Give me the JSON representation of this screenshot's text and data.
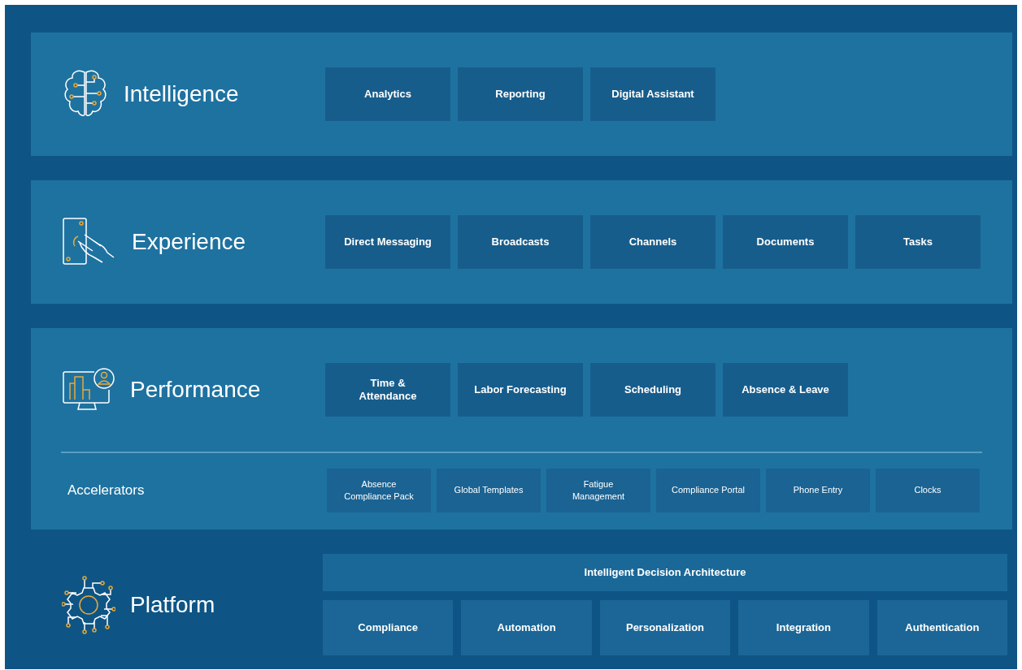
{
  "layers": [
    {
      "kind": "intelligence",
      "title": "Intelligence",
      "modules": [
        "Analytics",
        "Reporting",
        "Digital Assistant"
      ]
    },
    {
      "kind": "experience",
      "title": "Experience",
      "modules": [
        "Direct Messaging",
        "Broadcasts",
        "Channels",
        "Documents",
        "Tasks"
      ]
    },
    {
      "kind": "performance",
      "title": "Performance",
      "modules": [
        "Time &\nAttendance",
        "Labor Forecasting",
        "Scheduling",
        "Absence & Leave"
      ],
      "accelerators": {
        "label": "Accelerators",
        "items": [
          "Absence\nCompliance Pack",
          "Global Templates",
          "Fatigue\nManagement",
          "Compliance Portal",
          "Phone Entry",
          "Clocks"
        ]
      }
    }
  ],
  "platform": {
    "title": "Platform",
    "architecture": "Intelligent Decision Architecture",
    "modules": [
      "Compliance",
      "Automation",
      "Personalization",
      "Integration",
      "Authentication"
    ]
  }
}
